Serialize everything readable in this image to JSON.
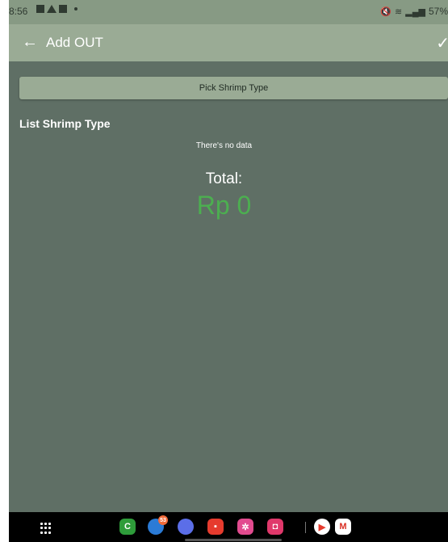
{
  "status_bar": {
    "time": "8:56",
    "battery": "57%",
    "icons": [
      "image-icon",
      "warning-icon",
      "mail-icon",
      "mute-icon",
      "wifi-icon",
      "signal-icon",
      "battery-icon"
    ]
  },
  "app_bar": {
    "title": "Add OUT",
    "back_icon": "arrow-left-icon",
    "confirm_icon": "check-icon"
  },
  "main": {
    "pick_button_label": "Pick Shrimp Type",
    "list_title": "List Shrimp Type",
    "empty_text": "There's no data",
    "total_label": "Total:",
    "total_value": "Rp 0"
  },
  "colors": {
    "background": "#5f6f65",
    "app_bar": "#9aab95",
    "total_value": "#4caf50"
  },
  "nav_bar": {
    "apps": [
      {
        "name": "phone",
        "color": "#2e9c3a"
      },
      {
        "name": "messages",
        "color": "#2b7bd6",
        "badge": "53"
      },
      {
        "name": "internet",
        "color": "#5b6ee8"
      },
      {
        "name": "flipboard",
        "color": "#e63b2e"
      },
      {
        "name": "bixby",
        "color": "#e24b8f"
      },
      {
        "name": "camera",
        "color": "#e0386b"
      },
      {
        "name": "play-store",
        "color": "#ffffff"
      },
      {
        "name": "gmail",
        "color": "#ffffff"
      }
    ]
  }
}
